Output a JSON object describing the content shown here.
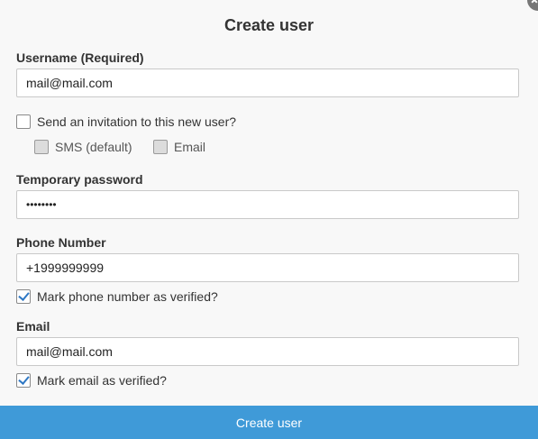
{
  "dialog": {
    "title": "Create user",
    "submit_label": "Create user"
  },
  "username": {
    "label": "Username (Required)",
    "value": "mail@mail.com"
  },
  "invitation": {
    "label": "Send an invitation to this new user?",
    "checked": false,
    "options": [
      {
        "label": "SMS (default)",
        "checked": false
      },
      {
        "label": "Email",
        "checked": false
      }
    ]
  },
  "password": {
    "label": "Temporary password",
    "value": "••••••••"
  },
  "phone": {
    "label": "Phone Number",
    "value": "+1999999999",
    "verified_label": "Mark phone number as verified?",
    "verified": true
  },
  "email": {
    "label": "Email",
    "value": "mail@mail.com",
    "verified_label": "Mark email as verified?",
    "verified": true
  },
  "colors": {
    "accent": "#3f9ad8",
    "check": "#2f78c4"
  }
}
